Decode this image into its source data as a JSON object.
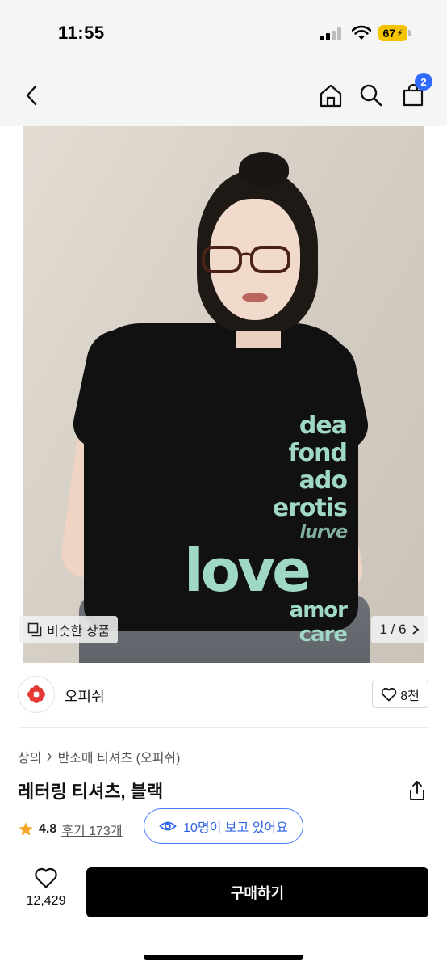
{
  "status": {
    "time": "11:55",
    "battery": "67"
  },
  "nav": {
    "cart_count": "2"
  },
  "gallery": {
    "print_words": [
      "dea",
      "fond",
      "ado",
      "erotis",
      "lurve",
      "love",
      "amor",
      "care"
    ],
    "similar_label": "비슷한 상품",
    "page_indicator": "1 / 6"
  },
  "brand": {
    "name": "오피쉬",
    "likes": "8천"
  },
  "breadcrumb": {
    "category": "상의",
    "subcategory": "반소매 티셔츠 (오피쉬)"
  },
  "product": {
    "title": "레터링 티셔츠, 블랙",
    "rating": "4.8",
    "reviews": "후기 173개",
    "viewers": "10명이 보고 있어요"
  },
  "bottom": {
    "wishlist_count": "12,429",
    "buy_label": "구매하기"
  },
  "colors": {
    "accent_blue": "#2f6bff",
    "star": "#f5a623",
    "buy_bg": "#000000",
    "brand_red": "#e53935",
    "print_mint": "#9fd8c6"
  },
  "icons": [
    "back-icon",
    "home-icon",
    "search-icon",
    "cart-icon",
    "similar-icon",
    "chevron-right-icon",
    "heart-icon",
    "share-icon",
    "star-icon",
    "eye-icon"
  ]
}
